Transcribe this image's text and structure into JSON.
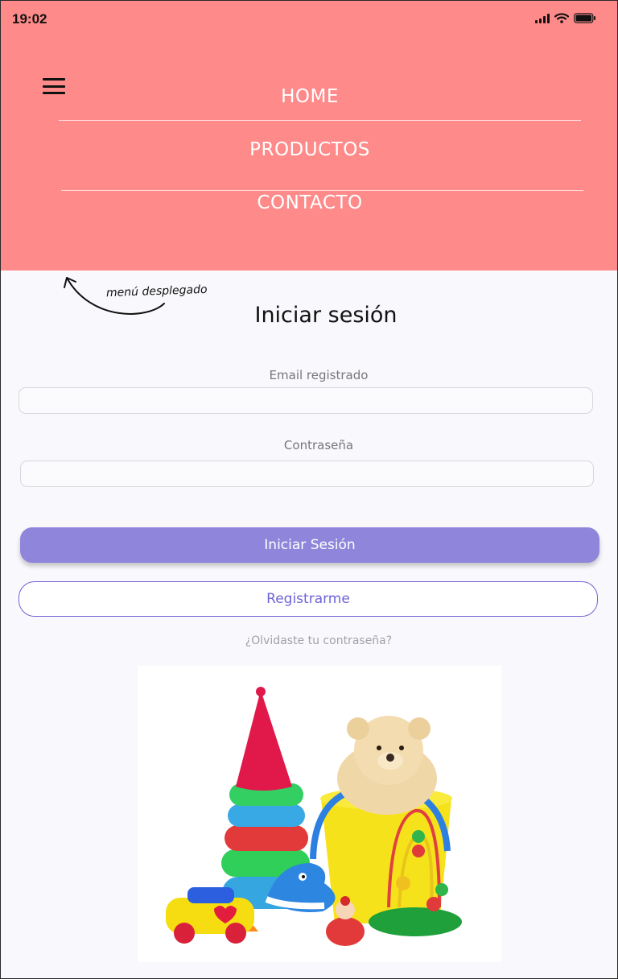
{
  "status_bar": {
    "time": "19:02"
  },
  "nav": {
    "items": [
      {
        "label": "HOME"
      },
      {
        "label": "PRODUCTOS"
      },
      {
        "label": "CONTACTO"
      }
    ]
  },
  "annotation": {
    "text": "menú desplegado"
  },
  "login": {
    "title": "Iniciar sesión",
    "email_label": "Email registrado",
    "email_value": "",
    "password_label": "Contraseña",
    "password_value": "",
    "submit_label": "Iniciar Sesión",
    "register_label": "Registrarme",
    "forgot_label": "¿Olvidaste tu contraseña?"
  },
  "colors": {
    "header_bg": "#ff8a8a",
    "primary_button": "#8f86db",
    "outline_accent": "#6e63d6",
    "page_bg": "#f9f9fd"
  },
  "icons": [
    "hamburger-icon",
    "signal-icon",
    "wifi-icon",
    "battery-icon",
    "curved-arrow-icon"
  ]
}
